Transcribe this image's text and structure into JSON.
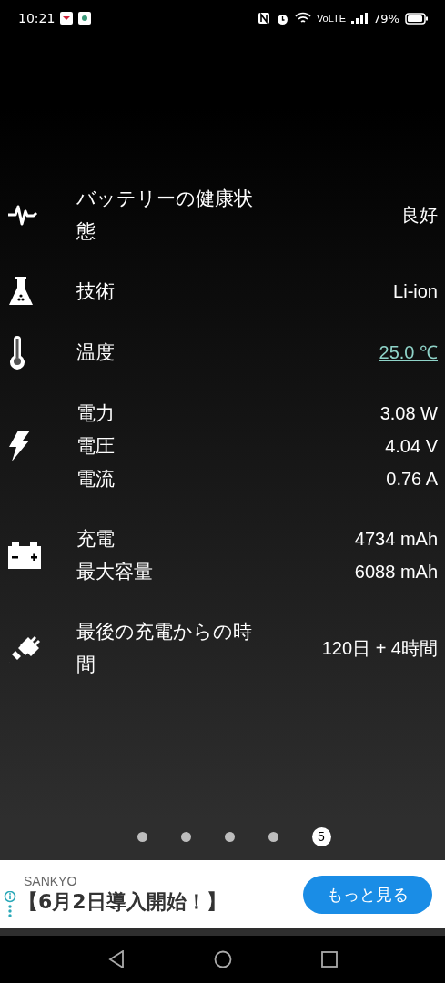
{
  "status_bar": {
    "time": "10:21",
    "network": "VoLTE",
    "battery": "79%"
  },
  "groups": [
    {
      "items": [
        {
          "label": "バッテリーの健康状態",
          "value": "良好",
          "link": false
        }
      ]
    },
    {
      "items": [
        {
          "label": "技術",
          "value": "Li-ion",
          "link": false
        }
      ]
    },
    {
      "items": [
        {
          "label": "温度",
          "value": "25.0 ℃",
          "link": true
        }
      ]
    },
    {
      "items": [
        {
          "label": "電力",
          "value": "3.08 W",
          "link": false
        },
        {
          "label": "電圧",
          "value": "4.04 V",
          "link": false
        },
        {
          "label": "電流",
          "value": "0.76 A",
          "link": false
        }
      ]
    },
    {
      "items": [
        {
          "label": "充電",
          "value": "4734 mAh",
          "link": false
        },
        {
          "label": "最大容量",
          "value": "6088 mAh",
          "link": false
        }
      ]
    },
    {
      "items": [
        {
          "label": "最後の充電からの時間",
          "value": "120日 + 4時間",
          "link": false
        }
      ]
    }
  ],
  "pages": [
    {
      "selected": false
    },
    {
      "selected": false
    },
    {
      "selected": false
    },
    {
      "selected": false
    },
    {
      "selected": true,
      "label": "5"
    }
  ],
  "ad": {
    "advertiser": "SANKYO",
    "headline": "【6月2日導入開始！】",
    "button": "もっと見る"
  }
}
